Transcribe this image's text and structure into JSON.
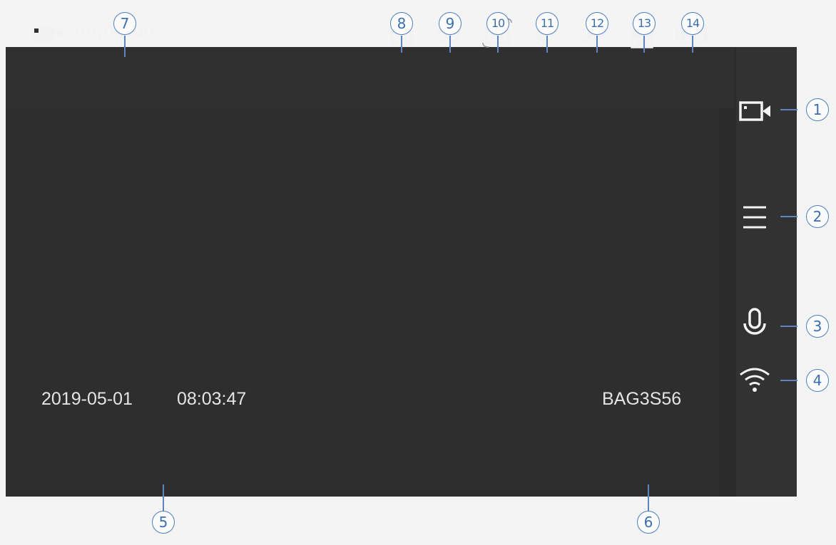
{
  "topbar": {
    "record_icon": "video-camera-icon",
    "timer": "00:00:00",
    "status_icons": [
      {
        "name": "lock-icon",
        "callout": "8"
      },
      {
        "name": "parking-mode-icon",
        "callout": "9"
      },
      {
        "name": "hdr-icon",
        "callout": "10"
      },
      {
        "name": "mic-muted-icon",
        "callout": "11"
      },
      {
        "name": "gps-off-icon",
        "callout": "12"
      },
      {
        "name": "sd-card-icon",
        "callout": "13"
      },
      {
        "name": "battery-icon",
        "callout": "14"
      }
    ]
  },
  "preview": {
    "date": "2019-05-01",
    "time": "08:03:47",
    "plate": "BAG3S56"
  },
  "sidebar": {
    "buttons": [
      {
        "name": "camera-switch-icon",
        "callout": "1"
      },
      {
        "name": "menu-icon",
        "callout": "2"
      },
      {
        "name": "microphone-icon",
        "callout": "3"
      },
      {
        "name": "wifi-icon",
        "callout": "4"
      }
    ]
  },
  "callouts": {
    "c1": "1",
    "c2": "2",
    "c3": "3",
    "c4": "4",
    "c5": "5",
    "c6": "6",
    "c7": "7",
    "c8": "8",
    "c9": "9",
    "c10": "10",
    "c11": "11",
    "c12": "12",
    "c13": "13",
    "c14": "14"
  },
  "colors": {
    "screen": "#2b2b2b",
    "icons": "#f2f2f2",
    "callout": "#3c6fb0"
  }
}
